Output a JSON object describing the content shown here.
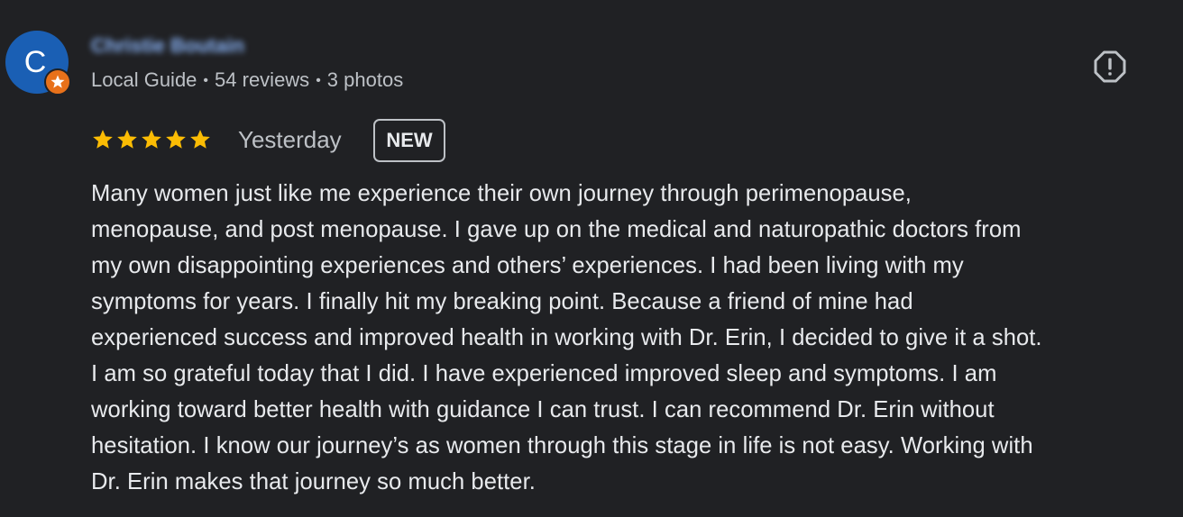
{
  "reviewer": {
    "avatar_letter": "C",
    "name": "Christie Boutain",
    "meta": {
      "role": "Local Guide",
      "reviews": "54 reviews",
      "photos": "3 photos",
      "separator": "•"
    },
    "badge_icon": "local-guide-star-icon",
    "colors": {
      "avatar_bg": "#1a5fb4",
      "badge_bg": "#e8711a",
      "name_color": "#8ab4f8"
    }
  },
  "report": {
    "icon": "report-alert-icon"
  },
  "rating": {
    "stars": 5,
    "max_stars": 5,
    "star_color": "#fbbc04",
    "date": "Yesterday",
    "badge": "NEW"
  },
  "review_text_lines": [
    "Many women just like me experience their own journey through perimenopause,",
    "menopause, and post menopause. I gave up on the medical and naturopathic doctors from",
    "my own disappointing experiences and others’ experiences. I had been living with my",
    "symptoms for years. I finally hit my breaking point. Because a friend of mine had",
    "experienced success and improved health in working with Dr. Erin, I decided to give it a shot.",
    "I am so grateful today that I did. I have experienced improved sleep and symptoms. I am",
    "working toward better health with guidance I can trust. I can recommend Dr. Erin without",
    "hesitation. I know our journey’s as women through this stage in life is not easy. Working with",
    "Dr. Erin makes that journey so much better."
  ]
}
